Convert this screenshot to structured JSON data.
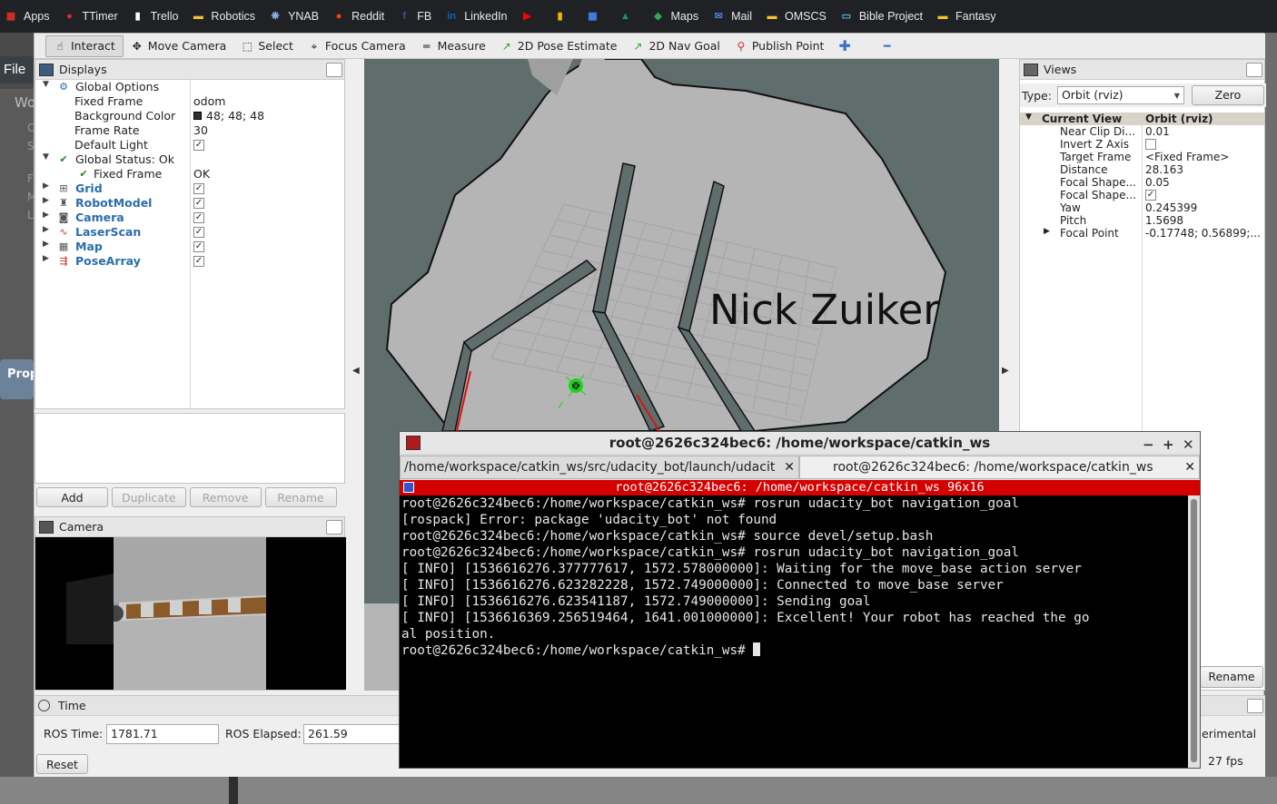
{
  "bookmarks": [
    {
      "label": "Apps",
      "icon": "apps-grid-icon",
      "color": "#d93025"
    },
    {
      "label": "TTimer",
      "icon": "ttimer-icon",
      "color": "#d93025"
    },
    {
      "label": "Trello",
      "icon": "trello-icon",
      "color": "#ffffff"
    },
    {
      "label": "Robotics",
      "icon": "folder-icon",
      "color": "#f4c430"
    },
    {
      "label": "YNAB",
      "icon": "ynab-icon",
      "color": "#8ab4f8"
    },
    {
      "label": "Reddit",
      "icon": "reddit-icon",
      "color": "#ff4500"
    },
    {
      "label": "FB",
      "icon": "facebook-icon",
      "color": "#3b5998"
    },
    {
      "label": "LinkedIn",
      "icon": "linkedin-icon",
      "color": "#0a66c2"
    },
    {
      "label": "",
      "icon": "youtube-icon",
      "color": "#ff0000"
    },
    {
      "label": "",
      "icon": "keep-icon",
      "color": "#f4b400"
    },
    {
      "label": "",
      "icon": "calendar-icon",
      "color": "#4285f4"
    },
    {
      "label": "",
      "icon": "drive-icon",
      "color": "#0f9d58"
    },
    {
      "label": "Maps",
      "icon": "maps-icon",
      "color": "#34a853"
    },
    {
      "label": "Mail",
      "icon": "mail-icon",
      "color": "#4a7bd0"
    },
    {
      "label": "OMSCS",
      "icon": "folder-icon",
      "color": "#f4c430"
    },
    {
      "label": "Bible Project",
      "icon": "monitor-icon",
      "color": "#4fb3d9"
    },
    {
      "label": "Fantasy",
      "icon": "folder-icon",
      "color": "#f4c430"
    }
  ],
  "background_app": {
    "file_menu": "File",
    "properties_label": "Prop",
    "side_letters": [
      "Wo",
      "C",
      "S",
      "F",
      "M",
      "L"
    ]
  },
  "toolbar": {
    "tools": [
      {
        "label": "Interact",
        "icon": "hand-pointer-icon",
        "active": true
      },
      {
        "label": "Move Camera",
        "icon": "move-camera-icon"
      },
      {
        "label": "Select",
        "icon": "select-box-icon"
      },
      {
        "label": "Focus Camera",
        "icon": "focus-crosshair-icon"
      },
      {
        "label": "Measure",
        "icon": "ruler-icon"
      },
      {
        "label": "2D Pose Estimate",
        "icon": "pose-arrow-icon"
      },
      {
        "label": "2D Nav Goal",
        "icon": "nav-goal-arrow-icon"
      },
      {
        "label": "Publish Point",
        "icon": "map-pin-icon"
      }
    ]
  },
  "displays": {
    "title": "Displays",
    "rows": [
      {
        "label": "Global Options",
        "value": "",
        "arrow": "▼",
        "indent": 0,
        "icon": "gear-icon"
      },
      {
        "label": "Fixed Frame",
        "value": "odom",
        "indent": 1
      },
      {
        "label": "Background Color",
        "value": "48; 48; 48",
        "indent": 1,
        "swatch": "#303030"
      },
      {
        "label": "Frame Rate",
        "value": "30",
        "indent": 1
      },
      {
        "label": "Default Light",
        "value": "",
        "indent": 1,
        "checked": true
      },
      {
        "label": "Global Status: Ok",
        "value": "",
        "arrow": "▼",
        "indent": 0,
        "icon": "checkmark-icon"
      },
      {
        "label": "Fixed Frame",
        "value": "OK",
        "indent": 1,
        "icon": "checkmark-icon"
      },
      {
        "label": "Grid",
        "arrow": "▶",
        "indent": 0,
        "icon": "grid-icon",
        "checked": true,
        "bold": true
      },
      {
        "label": "RobotModel",
        "arrow": "▶",
        "indent": 0,
        "icon": "robot-model-icon",
        "checked": true,
        "bold": true
      },
      {
        "label": "Camera",
        "arrow": "▶",
        "indent": 0,
        "icon": "camera-icon",
        "checked": true,
        "bold": true
      },
      {
        "label": "LaserScan",
        "arrow": "▶",
        "indent": 0,
        "icon": "laser-scan-icon",
        "checked": true,
        "bold": true
      },
      {
        "label": "Map",
        "arrow": "▶",
        "indent": 0,
        "icon": "map-icon",
        "checked": true,
        "bold": true
      },
      {
        "label": "PoseArray",
        "arrow": "▶",
        "indent": 0,
        "icon": "pose-array-icon",
        "checked": true,
        "bold": true
      }
    ],
    "buttons": {
      "add": "Add",
      "duplicate": "Duplicate",
      "remove": "Remove",
      "rename": "Rename"
    }
  },
  "camera_panel": {
    "title": "Camera"
  },
  "view3d": {
    "watermark": "Nick Zuiker"
  },
  "views": {
    "title": "Views",
    "type_label": "Type:",
    "type_value": "Orbit (rviz)",
    "zero_button": "Zero",
    "header": {
      "label": "Current View",
      "value": "Orbit (rviz)"
    },
    "rows": [
      {
        "label": "Near Clip Di...",
        "value": "0.01"
      },
      {
        "label": "Invert Z Axis",
        "value": "",
        "checkbox": true,
        "checked": false
      },
      {
        "label": "Target Frame",
        "value": "<Fixed Frame>"
      },
      {
        "label": "Distance",
        "value": "28.163"
      },
      {
        "label": "Focal Shape...",
        "value": "0.05"
      },
      {
        "label": "Focal Shape...",
        "value": "",
        "checkbox": true,
        "checked": true
      },
      {
        "label": "Yaw",
        "value": "0.245399"
      },
      {
        "label": "Pitch",
        "value": "1.5698"
      },
      {
        "label": "Focal Point",
        "value": "-0.17748; 0.56899;...",
        "arrow": "▶"
      }
    ],
    "rename_button": "Rename"
  },
  "time_panel": {
    "title": "Time",
    "ros_time_label": "ROS Time:",
    "ros_time_value": "1781.71",
    "ros_elapsed_label": "ROS Elapsed:",
    "ros_elapsed_value": "261.59",
    "reset_button": "Reset",
    "experimental_label": "erimental",
    "fps": "27 fps"
  },
  "terminal": {
    "title": "root@2626c324bec6: /home/workspace/catkin_ws",
    "tabs": [
      {
        "label": "/home/workspace/catkin_ws/src/udacity_bot/launch/udacit"
      },
      {
        "label": "root@2626c324bec6: /home/workspace/catkin_ws",
        "active": true
      }
    ],
    "status_bar": "root@2626c324bec6: /home/workspace/catkin_ws 96x16",
    "lines": [
      "root@2626c324bec6:/home/workspace/catkin_ws# rosrun udacity_bot navigation_goal",
      "[rospack] Error: package 'udacity_bot' not found",
      "root@2626c324bec6:/home/workspace/catkin_ws# source devel/setup.bash",
      "root@2626c324bec6:/home/workspace/catkin_ws# rosrun udacity_bot navigation_goal",
      "[ INFO] [1536616276.377777617, 1572.578000000]: Waiting for the move_base action server",
      "[ INFO] [1536616276.623282228, 1572.749000000]: Connected to move_base server",
      "[ INFO] [1536616276.623541187, 1572.749000000]: Sending goal",
      "[ INFO] [1536616369.256519464, 1641.001000000]: Excellent! Your robot has reached the go",
      "al position."
    ],
    "prompt": "root@2626c324bec6:/home/workspace/catkin_ws# "
  }
}
